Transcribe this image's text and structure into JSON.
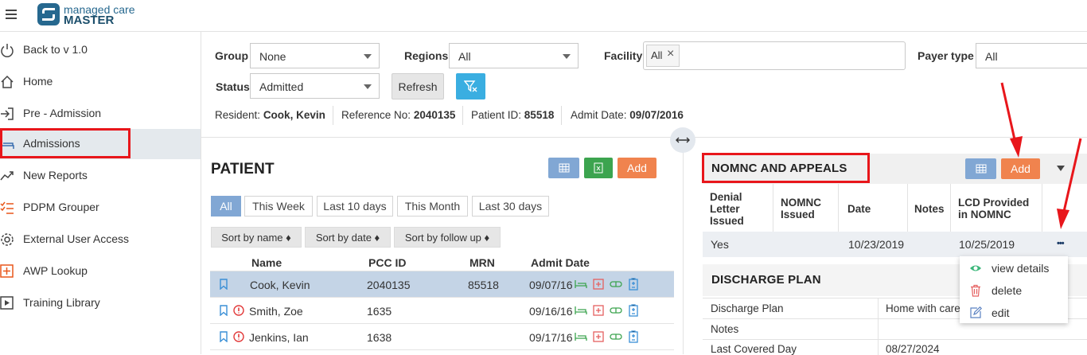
{
  "app": {
    "logo_line1": "managed care",
    "logo_line2": "MASTER"
  },
  "sidebar": {
    "items": [
      {
        "label": "Back to v 1.0",
        "icon": "power-icon"
      },
      {
        "label": "Home",
        "icon": "home-icon"
      },
      {
        "label": "Pre - Admission",
        "icon": "sign-in-icon"
      },
      {
        "label": "Admissions",
        "icon": "bed-icon",
        "active": true
      },
      {
        "label": "New Reports",
        "icon": "trend-chart-icon"
      },
      {
        "label": "PDPM Grouper",
        "icon": "list-check-icon"
      },
      {
        "label": "External User Access",
        "icon": "gear-icon"
      },
      {
        "label": "AWP Lookup",
        "icon": "plus-square-icon"
      },
      {
        "label": "Training Library",
        "icon": "play-square-icon"
      }
    ]
  },
  "filters": {
    "group_label": "Group",
    "group_value": "None",
    "regions_label": "Regions",
    "regions_value": "All",
    "facility_label": "Facility",
    "facility_chip": "All",
    "payer_label": "Payer type",
    "payer_value": "All",
    "status_label": "Status",
    "status_value": "Admitted",
    "refresh_label": "Refresh"
  },
  "resident": {
    "resident_label": "Resident:",
    "resident_value": "Cook, Kevin",
    "ref_label": "Reference No:",
    "ref_value": "2040135",
    "pid_label": "Patient ID:",
    "pid_value": "85518",
    "admit_label": "Admit Date:",
    "admit_value": "09/07/2016"
  },
  "patient": {
    "title": "PATIENT",
    "add_label": "Add",
    "tabs": [
      "All",
      "This Week",
      "Last 10 days",
      "This Month",
      "Last 30 days"
    ],
    "sorts": [
      "Sort by name ♦",
      "Sort by date ♦",
      "Sort by follow up ♦"
    ],
    "columns": [
      "Name",
      "PCC ID",
      "MRN",
      "Admit Date"
    ],
    "rows": [
      {
        "name": "Cook, Kevin",
        "pcc": "2040135",
        "mrn": "85518",
        "date": "09/07/16",
        "alert": false
      },
      {
        "name": "Smith, Zoe",
        "pcc": "1635",
        "mrn": "",
        "date": "09/16/16",
        "alert": true
      },
      {
        "name": "Jenkins, Ian",
        "pcc": "1638",
        "mrn": "",
        "date": "09/17/16",
        "alert": true
      }
    ]
  },
  "nomnc": {
    "title": "NOMNC AND APPEALS",
    "add_label": "Add",
    "columns": [
      "Denial Letter Issued",
      "NOMNC Issued",
      "Date",
      "Notes",
      "LCD Provided in NOMNC"
    ],
    "row": {
      "denial": "Yes",
      "nomnc": "",
      "date": "10/23/2019",
      "notes": "",
      "lcd": "10/25/2019"
    },
    "more_icon": "•••"
  },
  "context_menu": {
    "items": [
      {
        "label": "view details",
        "icon": "eye-icon"
      },
      {
        "label": "delete",
        "icon": "trash-icon"
      },
      {
        "label": "edit",
        "icon": "edit-icon"
      }
    ]
  },
  "discharge": {
    "title": "DISCHARGE PLAN",
    "rows": [
      {
        "label": "Discharge Plan",
        "value": "Home with care"
      },
      {
        "label": "Notes",
        "value": ""
      },
      {
        "label": "Last Covered Day",
        "value": "08/27/2024"
      }
    ]
  },
  "colors": {
    "accent_blue": "#81a7d4",
    "accent_green": "#3ca44f",
    "accent_orange": "#f0834e",
    "cyan": "#3aaee1",
    "annotation_red": "#e8161b"
  }
}
